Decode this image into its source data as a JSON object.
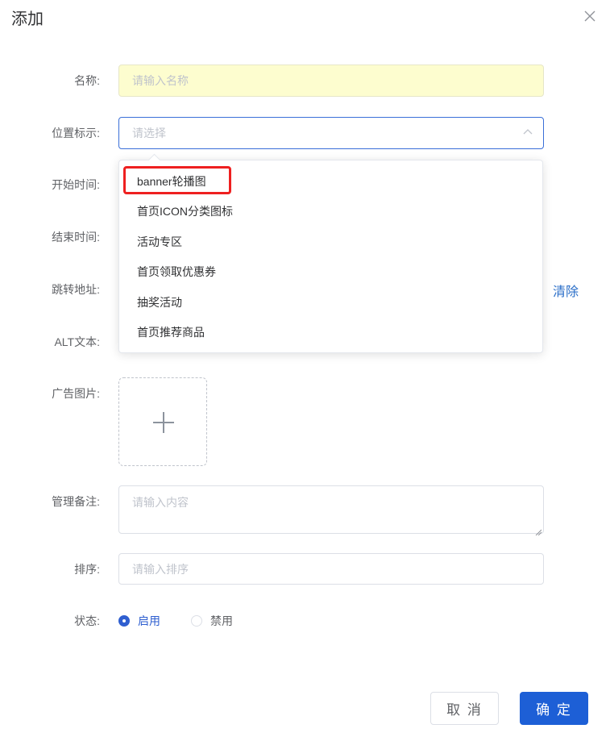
{
  "dialog": {
    "title": "添加"
  },
  "form": {
    "name": {
      "label": "名称:",
      "placeholder": "请输入名称"
    },
    "position": {
      "label": "位置标示:",
      "placeholder": "请选择"
    },
    "start_time": {
      "label": "开始时间:"
    },
    "end_time": {
      "label": "结束时间:"
    },
    "jump_url": {
      "label": "跳转地址:",
      "clear_label": "清除"
    },
    "alt_text": {
      "label": "ALT文本:"
    },
    "ad_image": {
      "label": "广告图片:"
    },
    "admin_note": {
      "label": "管理备注:",
      "placeholder": "请输入内容"
    },
    "sort": {
      "label": "排序:",
      "placeholder": "请输入排序"
    },
    "status": {
      "label": "状态:",
      "options": [
        {
          "label": "启用",
          "checked": true
        },
        {
          "label": "禁用",
          "checked": false
        }
      ]
    }
  },
  "dropdown": {
    "options": [
      "banner轮播图",
      "首页ICON分类图标",
      "活动专区",
      "首页领取优惠券",
      "抽奖活动",
      "首页推荐商品"
    ]
  },
  "footer": {
    "cancel_label": "取 消",
    "confirm_label": "确 定"
  },
  "colors": {
    "primary": "#1d5fd6",
    "highlight_border": "#ee2020",
    "name_input_bg": "#fdfdcf"
  },
  "icons": {
    "close": "close-icon",
    "chevron": "chevron-up-icon",
    "plus": "plus-icon"
  }
}
